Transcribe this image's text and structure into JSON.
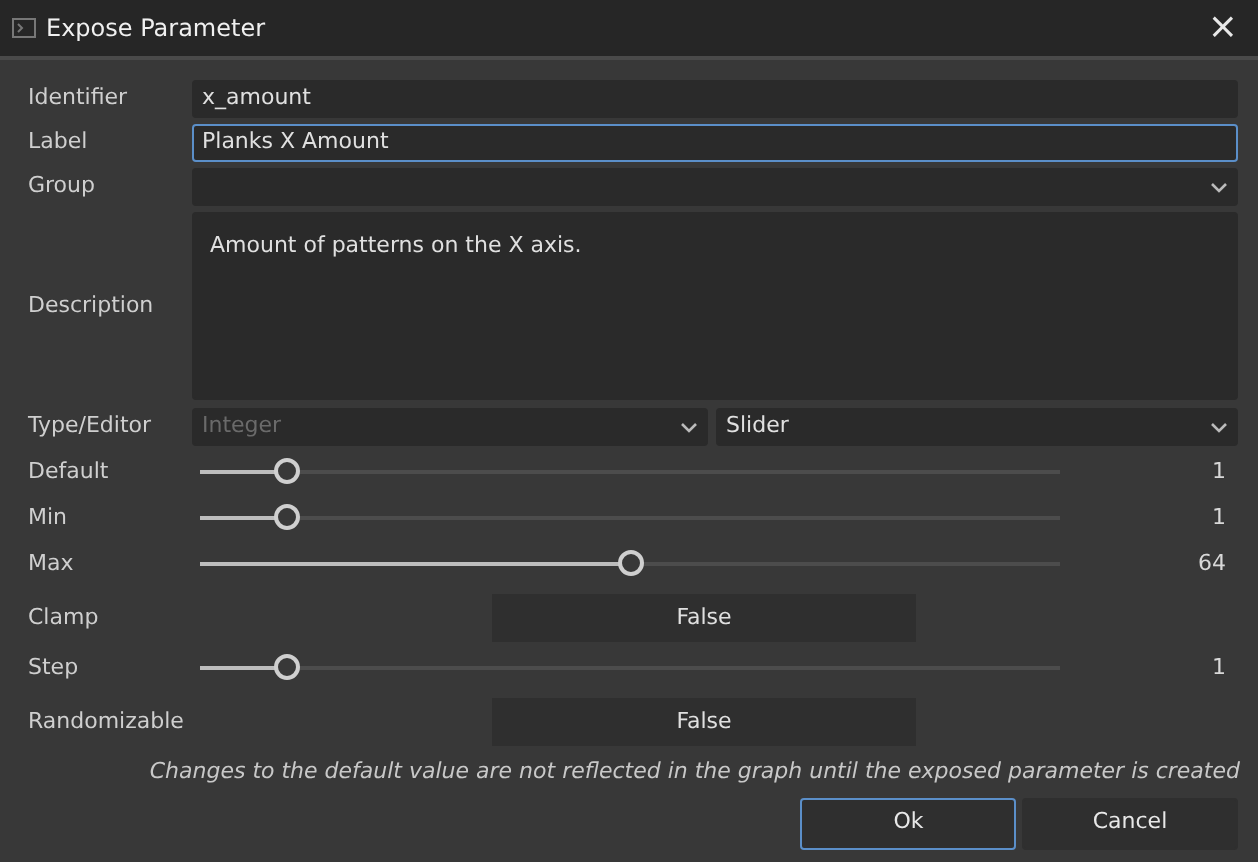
{
  "window": {
    "title": "Expose Parameter",
    "close": "×"
  },
  "rows": [
    {
      "kind": "text",
      "label": "Identifier",
      "value": "x_amount",
      "focused": false
    },
    {
      "kind": "text",
      "label": "Label",
      "value": "Planks X Amount",
      "focused": true
    },
    {
      "kind": "combo",
      "label": "Group",
      "value": ""
    },
    {
      "kind": "textarea",
      "label": "Description",
      "value": "Amount of patterns on the X axis."
    },
    {
      "kind": "dualcombo",
      "label": "Type/Editor",
      "combos": [
        {
          "value": "Integer",
          "disabled": true
        },
        {
          "value": "Slider",
          "disabled": false
        }
      ]
    },
    {
      "kind": "slider",
      "label": "Default",
      "level": 0.1,
      "reading": "1"
    },
    {
      "kind": "slider",
      "label": "Min",
      "level": 0.1,
      "reading": "1"
    },
    {
      "kind": "slider",
      "label": "Max",
      "level": 0.5,
      "reading": "64"
    },
    {
      "kind": "toggle",
      "label": "Clamp",
      "value": "False"
    },
    {
      "kind": "slider",
      "label": "Step",
      "level": 0.1,
      "reading": "1"
    },
    {
      "kind": "toggle",
      "label": "Randomizable",
      "value": "False"
    }
  ],
  "note": "Changes to the default value are not reflected in the graph until the exposed parameter is created",
  "buttons": [
    {
      "label": "Ok",
      "focused": true
    },
    {
      "label": "Cancel",
      "focused": false
    }
  ]
}
